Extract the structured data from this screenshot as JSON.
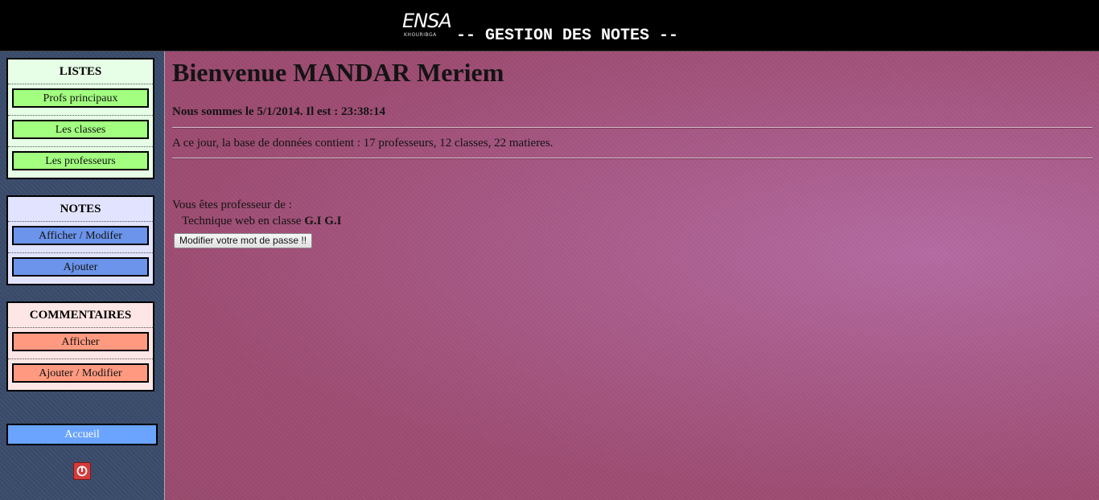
{
  "header": {
    "logo_text": "ENSA",
    "logo_subtext": "KHOURIBGA",
    "title": "-- GESTION DES NOTES --"
  },
  "sidebar": {
    "listes": {
      "title": "LISTES",
      "items": [
        "Profs principaux",
        "Les classes",
        "Les professeurs"
      ]
    },
    "notes": {
      "title": "NOTES",
      "items": [
        "Afficher / Modifer",
        "Ajouter"
      ]
    },
    "commentaires": {
      "title": "COMMENTAIRES",
      "items": [
        "Afficher",
        "Ajouter / Modifier"
      ]
    },
    "accueil_label": "Accueil",
    "power_icon": "power-icon"
  },
  "main": {
    "welcome": "Bienvenue MANDAR Meriem",
    "datetime": "Nous sommes le 5/1/2014. Il est : 23:38:14",
    "db_summary": "A ce jour, la base de données contient : 17 professeurs, 12 classes, 22 matieres.",
    "prof_of_label": "Vous êtes professeur de :",
    "course_text": "Technique web en classe ",
    "course_class": "G.I G.I",
    "change_password_label": "Modifier votre mot de passe !!"
  },
  "colors": {
    "listes_button": "#a2ff80",
    "notes_button": "#6b94ea",
    "commentaires_button": "#ff9a80",
    "accueil_button": "#6aa4ff",
    "main_background": "#a85a88",
    "sidebar_background": "#3a4b6b"
  }
}
